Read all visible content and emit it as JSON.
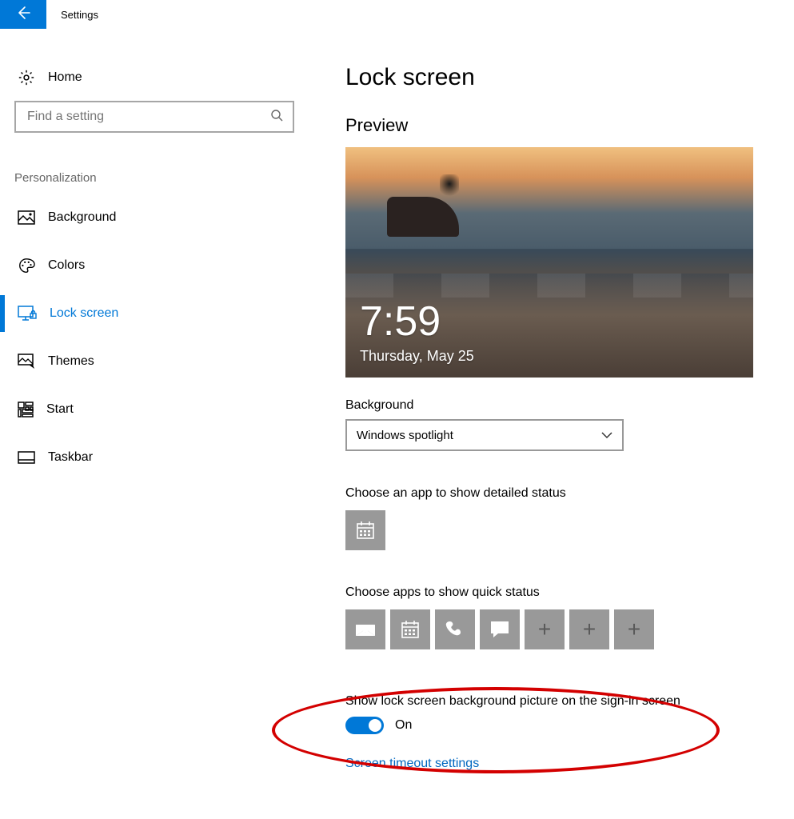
{
  "titlebar": {
    "title": "Settings"
  },
  "sidebar": {
    "home": "Home",
    "search_placeholder": "Find a setting",
    "section": "Personalization",
    "items": [
      {
        "label": "Background"
      },
      {
        "label": "Colors"
      },
      {
        "label": "Lock screen",
        "active": true
      },
      {
        "label": "Themes"
      },
      {
        "label": "Start"
      },
      {
        "label": "Taskbar"
      }
    ]
  },
  "content": {
    "heading": "Lock screen",
    "preview_label": "Preview",
    "preview_time": "7:59",
    "preview_date": "Thursday, May 25",
    "background_label": "Background",
    "background_value": "Windows spotlight",
    "detailed_status_label": "Choose an app to show detailed status",
    "quick_status_label": "Choose apps to show quick status",
    "toggle_label": "Show lock screen background picture on the sign-in screen",
    "toggle_state": "On",
    "link": "Screen timeout settings"
  }
}
